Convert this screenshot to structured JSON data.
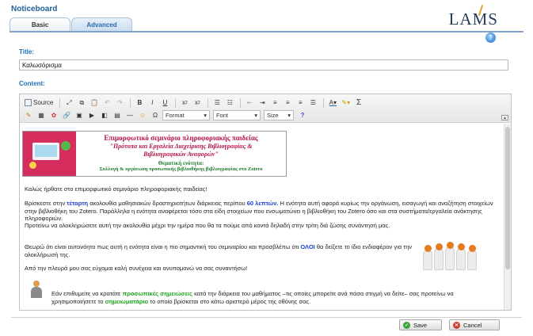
{
  "app": {
    "title": "Noticeboard",
    "logo_text": "LAMS"
  },
  "tabs": [
    {
      "label": "Basic",
      "active": true
    },
    {
      "label": "Advanced",
      "active": false
    }
  ],
  "help_icon": "question-icon",
  "form": {
    "title_label": "Title:",
    "title_value": "Καλωσόρισμα",
    "content_label": "Content:"
  },
  "toolbar": {
    "source_label": "Source",
    "format_label": "Format",
    "font_label": "Font",
    "size_label": "Size",
    "bold": "B",
    "italic": "I",
    "underline": "U",
    "subscript": "x",
    "superscript": "x",
    "sigma": "Σ",
    "omega": "Ω",
    "help": "?"
  },
  "banner": {
    "line1": "Επιμορφωτικό σεμινάριο πληροφοριακής παιδείας",
    "line2": "\"Πρότυπα και Εργαλεία Διαχείρισης Βιβλιογραφίας &",
    "line3": "Βιβλιογραφικών Αναφορών\"",
    "line4": "Θεματική ενότητα:",
    "line5": "Συλλογή & οργάνωση προσωπικής βιβλιοθήκης βιβλιογραφίας στο Zotero"
  },
  "body": {
    "welcome": "Καλώς ήρθατε στο επιμορφωτικό σεμινάριο πληροφοριακής παιδείας!",
    "p1_a": "Βρίσκεστε στην ",
    "p1_b": "τέταρτη",
    "p1_c": " ακολουθία μαθησιακών δραστηριοτήτων διάρκειας περίπου ",
    "p1_d": "60 λεπτών.",
    "p1_e": " Η ενότητα αυτή αφορά κυρίως την οργάνωση, εισαγωγή και αναζήτηση στοιχείων στην βιβλιοθήκη του Zotero. Παράλληλα η ενότητα αναφέρεται τόσο στα είδη στοιχείων που ενσωματώνει η βιβλιοθήκη του Zotero όσο και στα συστήματα/εργαλεία ανάκτησης πληροφοριών.",
    "p2": "Προτείνω να ολοκληρώσετε αυτή την ακολουθία μέχρι την ημέρα που θα τα πούμε από κοντά δηλαδή στην τρίτη διά ζώσης συνάντησή μας.",
    "p3_a": "Θεωρώ ότι είναι αυτονόητο πως αυτή η ενότητα είναι η πιο σημαντική του σεμιναρίου και προσβλέπω ότι ",
    "p3_b": "ΟΛΟΙ",
    "p3_c": " θα δείξετε το ίδιο ενδιαφέρον για την ολοκλήρωσή της.",
    "p4": "Από την πλευρά μου σας εύχομαι καλή συνέχεια και ανυπομονώ να σας συναντήσω!",
    "p5_a": "Εάν επιθυμείτε να κρατάτε ",
    "p5_b": "προσωπικές σημειώσεις",
    "p5_c": " κατά την διάρκεια του μαθήματος –τις οποίες μπορείτε ανά πάσα στιγμή να δείτε– σας προτείνω να χρησιμοποιήσετε το ",
    "p5_d": "σημειωματάριο",
    "p5_e": " το οποίο βρίσκεται στο κάτω αριστερό μέρος της οθόνης σας."
  },
  "buttons": {
    "save": "Save",
    "cancel": "Cancel"
  },
  "colors": {
    "accent": "#1d6fb8",
    "highlight_blue": "#1b3fd1",
    "highlight_green": "#1ba51b",
    "banner_red": "#b4103e"
  }
}
